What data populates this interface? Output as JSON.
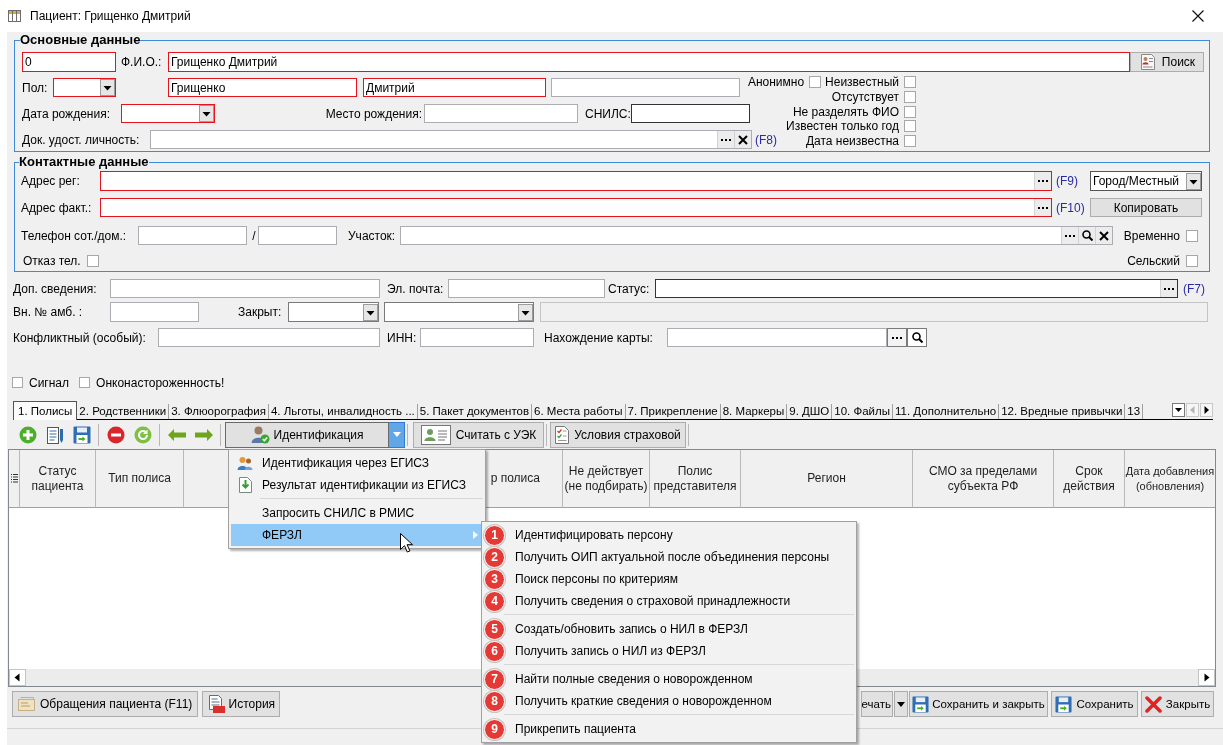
{
  "window": {
    "title": "Пациент: Грищенко Дмитрий"
  },
  "main_group": {
    "title": "Основные данные",
    "rows": [
      [
        {
          "kind": "field",
          "value": "0",
          "required": true
        },
        {
          "kind": "label",
          "text": "Ф.И.О.:"
        },
        {
          "kind": "field",
          "value": "Грищенко Дмитрий",
          "required": true
        },
        {
          "kind": "button",
          "text": "Поиск"
        }
      ],
      [
        {
          "kind": "label",
          "text": "Пол:"
        },
        {
          "kind": "combo",
          "required": true
        },
        {
          "kind": "field",
          "value": "Грищенко",
          "required": true
        },
        {
          "kind": "field",
          "value": "Дмитрий",
          "required": true
        },
        {
          "kind": "field",
          "required": false
        }
      ],
      [
        {
          "kind": "label",
          "text": "Дата рождения:"
        },
        {
          "kind": "combo",
          "required": true
        },
        {
          "kind": "label",
          "text": "Место рождения:"
        },
        {
          "kind": "field",
          "required": false
        },
        {
          "kind": "label",
          "text": "СНИЛС:"
        },
        {
          "kind": "field",
          "required": false
        }
      ],
      [
        {
          "kind": "label",
          "text": "Док. удост. личность:"
        },
        {
          "kind": "field",
          "required": false,
          "buttons": [
            {
              "kind": "browse"
            },
            {
              "kind": "clear"
            }
          ]
        },
        {
          "kind": "hotkey",
          "text": "(F8)"
        }
      ]
    ],
    "flags": [
      {
        "label": "Анонимно",
        "checked": false
      },
      {
        "label": "Неизвестный",
        "checked": false
      },
      {
        "label": "Отсутствует",
        "checked": false
      },
      {
        "label": "Не разделять ФИО",
        "checked": false
      },
      {
        "label": "Известен только год",
        "checked": false
      },
      {
        "label": "Дата неизвестна",
        "checked": false
      }
    ]
  },
  "contact_group": {
    "title": "Контактные данные",
    "rows": [
      [
        {
          "kind": "label",
          "text": "Адрес рег:"
        },
        {
          "kind": "field",
          "required": true,
          "buttons": [
            {
              "kind": "browse"
            }
          ]
        },
        {
          "kind": "hotkey",
          "text": "(F9)"
        },
        {
          "kind": "combo",
          "value": "Город/Местный",
          "required": false
        }
      ],
      [
        {
          "kind": "label",
          "text": "Адрес факт.:"
        },
        {
          "kind": "field",
          "required": true,
          "buttons": [
            {
              "kind": "browse"
            }
          ]
        },
        {
          "kind": "hotkey",
          "text": "(F10)"
        },
        {
          "kind": "button",
          "text": "Копировать"
        }
      ],
      [
        {
          "kind": "label",
          "text": "Телефон сот./дом.:"
        },
        {
          "kind": "field",
          "required": false
        },
        {
          "kind": "label",
          "text": "/"
        },
        {
          "kind": "field",
          "required": false
        },
        {
          "kind": "label",
          "text": "Участок:"
        },
        {
          "kind": "field",
          "required": false,
          "buttons": [
            {
              "kind": "browse"
            },
            {
              "kind": "search"
            },
            {
              "kind": "clear"
            }
          ]
        },
        {
          "kind": "checkbox",
          "label": "Временно",
          "checked": false
        }
      ],
      [
        {
          "kind": "checkbox",
          "label": "Отказ тел.",
          "checked": false
        },
        {
          "kind": "checkbox",
          "label": "Сельский",
          "checked": false
        }
      ]
    ]
  },
  "extra_rows": [
    [
      {
        "kind": "label",
        "text": "Доп. сведения:"
      },
      {
        "kind": "field",
        "required": false,
        "disabled": false
      },
      {
        "kind": "label",
        "text": "Эл. почта:"
      },
      {
        "kind": "field",
        "required": false,
        "disabled": false
      },
      {
        "kind": "label",
        "text": "Статус:"
      },
      {
        "kind": "field",
        "required": false,
        "disabled": false,
        "buttons": [
          {
            "kind": "browse"
          }
        ]
      },
      {
        "kind": "hotkey",
        "text": "(F7)"
      }
    ],
    [
      {
        "kind": "label",
        "text": "Вн. № амб. :"
      },
      {
        "kind": "field",
        "required": false,
        "disabled": false
      },
      {
        "kind": "label",
        "text": "Закрыт:"
      },
      {
        "kind": "combo",
        "required": false
      },
      {
        "kind": "combo",
        "required": false
      },
      {
        "kind": "field",
        "required": false,
        "disabled": true
      }
    ],
    [
      {
        "kind": "label",
        "text": "Конфликтный (особый):"
      },
      {
        "kind": "field",
        "required": false,
        "disabled": false
      },
      {
        "kind": "label",
        "text": "ИНН:"
      },
      {
        "kind": "field",
        "required": false,
        "disabled": false
      },
      {
        "kind": "label",
        "text": "Нахождение карты:"
      },
      {
        "kind": "field",
        "required": false,
        "disabled": false
      },
      {
        "kind": "browse"
      },
      {
        "kind": "search"
      }
    ]
  ],
  "extra_flags": [
    {
      "label": "Сигнал",
      "checked": false
    },
    {
      "label": "Онконастороженность!",
      "checked": false
    }
  ],
  "tabs": [
    {
      "label": "1. Полисы",
      "selected": true
    },
    {
      "label": "2. Родственники",
      "selected": false
    },
    {
      "label": "3. Флюорография",
      "selected": false
    },
    {
      "label": "4. Льготы, инвалидность ...",
      "selected": false
    },
    {
      "label": "5. Пакет документов",
      "selected": false
    },
    {
      "label": "6. Места работы",
      "selected": false
    },
    {
      "label": "7. Прикрепление",
      "selected": false
    },
    {
      "label": "8. Маркеры",
      "selected": false
    },
    {
      "label": "9. ДШО",
      "selected": false
    },
    {
      "label": "10. Файлы",
      "selected": false
    },
    {
      "label": "11. Дополнительно",
      "selected": false
    },
    {
      "label": "12. Вредные привычки",
      "selected": false
    },
    {
      "label": "13",
      "selected": false
    }
  ],
  "tab_scroll": {
    "previous_disabled": true,
    "next_disabled": false
  },
  "toolbar": {
    "identify": {
      "label": "Идентификация",
      "menu_open": true
    },
    "buttons": [
      {
        "label": "Считать с УЭК"
      },
      {
        "label": "Условия страховой"
      }
    ]
  },
  "table": {
    "columns": [
      {
        "label": "Статус пациента"
      },
      {
        "label": "Тип полиса"
      },
      {
        "label": "р полиса"
      },
      {
        "label": "Не действует (не подбирать)"
      },
      {
        "label": "Полис представителя"
      },
      {
        "label": "Регион"
      },
      {
        "label": "СМО за пределами субъекта РФ"
      },
      {
        "label": "Срок действия"
      },
      {
        "label": "Дата добавления (обновления)"
      }
    ]
  },
  "bottom_bar": {
    "left": [
      {
        "label": "Обращения пациента (F11)"
      },
      {
        "label": "История"
      }
    ],
    "print": {
      "label": "ечать"
    },
    "right": [
      {
        "label": "Сохранить и закрыть"
      },
      {
        "label": "Сохранить"
      },
      {
        "label": "Закрыть"
      }
    ]
  },
  "identify_menu": {
    "groups": [
      [
        {
          "label": "Идентификация через ЕГИСЗ",
          "selected": false,
          "submenu": false
        },
        {
          "label": "Результат идентификации из ЕГИСЗ",
          "selected": false,
          "submenu": false
        }
      ],
      [
        {
          "label": "Запросить СНИЛС в РМИС",
          "selected": false,
          "submenu": false
        },
        {
          "label": "ФЕРЗЛ",
          "selected": true,
          "submenu": true
        }
      ]
    ]
  },
  "ferzl_submenu": {
    "groups": [
      [
        {
          "number": "1",
          "label": "Идентифицировать персону",
          "selected": false
        },
        {
          "number": "2",
          "label": "Получить ОИП актуальной после объединения персоны",
          "selected": false
        },
        {
          "number": "3",
          "label": "Поиск персоны по критериям",
          "selected": false
        },
        {
          "number": "4",
          "label": "Получить сведения о страховой принадлежности",
          "selected": false
        }
      ],
      [
        {
          "number": "5",
          "label": "Создать/обновить запись о НИЛ в ФЕРЗЛ",
          "selected": false
        },
        {
          "number": "6",
          "label": "Получить запись о НИЛ из ФЕРЗЛ",
          "selected": false
        }
      ],
      [
        {
          "number": "7",
          "label": "Найти полные сведения о новорожденном",
          "selected": false
        },
        {
          "number": "8",
          "label": "Получить краткие сведения о новорожденном",
          "selected": false
        }
      ],
      [
        {
          "number": "9",
          "label": "Прикрепить пациента",
          "selected": false
        }
      ]
    ]
  }
}
